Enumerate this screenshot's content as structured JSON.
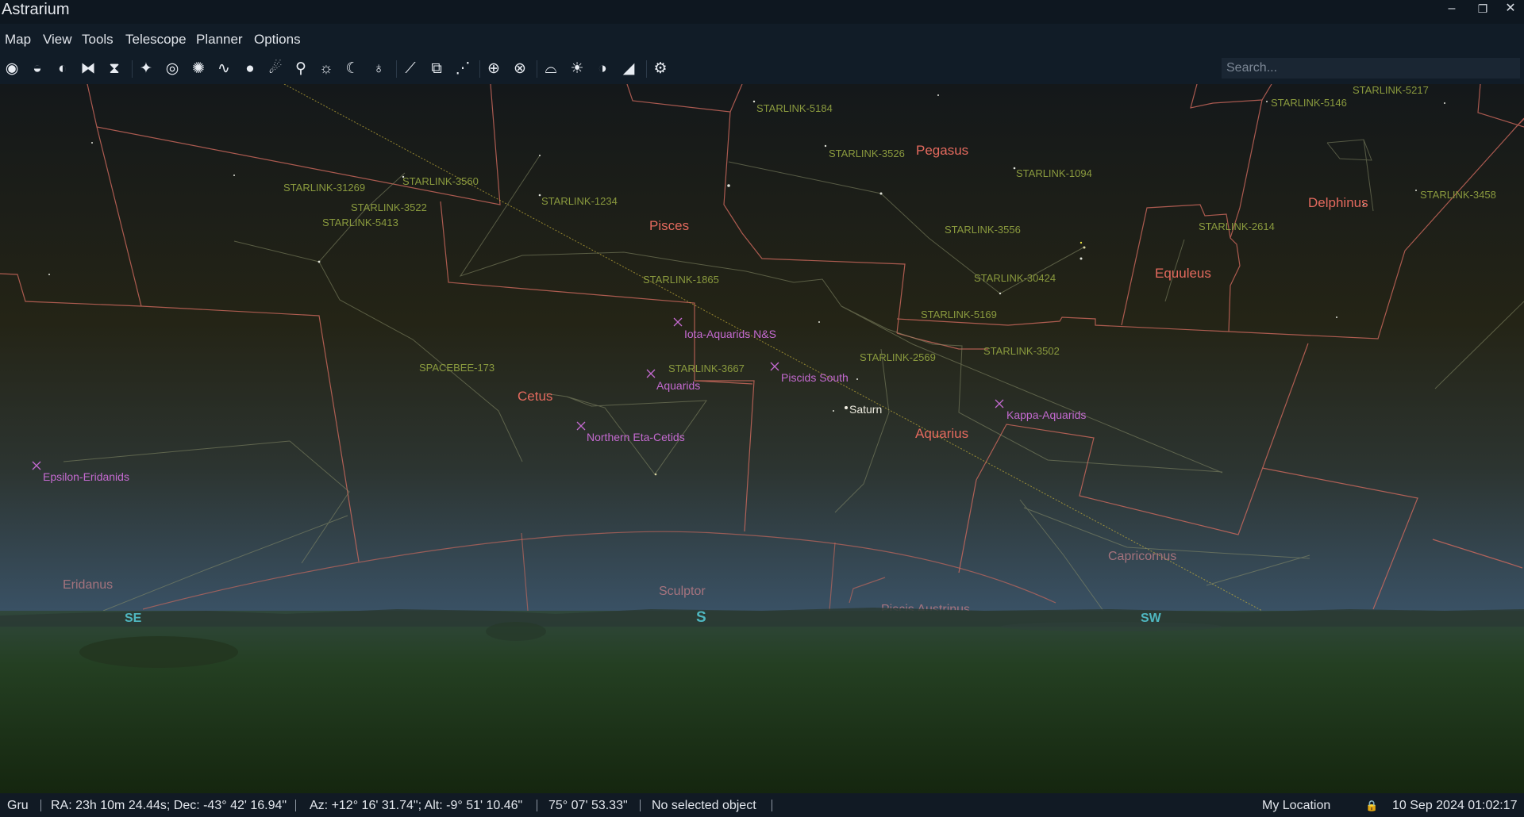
{
  "window": {
    "title": "Astrarium",
    "minimize_glyph": "–",
    "restore_glyph": "❐",
    "close_glyph": "✕"
  },
  "menu": [
    "Map",
    "View",
    "Tools",
    "Telescope",
    "Planner",
    "Options"
  ],
  "toolbar": {
    "buttons": [
      "owl-icon",
      "ground-icon",
      "atmosphere-icon",
      "mirror-flip-icon",
      "invert-icon",
      "stars-icon",
      "galaxy-icon",
      "star-cluster-icon",
      "nebula-icon",
      "comet-icon",
      "asteroid-icon",
      "satellite-icon",
      "sun-icon",
      "moon-icon",
      "planet-icon",
      "constellation-lines-icon",
      "constellation-borders-icon",
      "asterism-icon",
      "equatorial-grid-icon",
      "horizontal-grid-icon",
      "milky-way-icon",
      "daylight-icon",
      "moon-phase-icon",
      "landscape-icon",
      "settings-icon"
    ],
    "search_placeholder": "Search..."
  },
  "sky": {
    "constellations": [
      "Pegasus",
      "Pisces",
      "Delphinus",
      "Equuleus",
      "Cetus",
      "Aquarius",
      "Capricornus",
      "Eridanus",
      "Sculptor",
      "Piscis Austrinus"
    ],
    "satellites": [
      "STARLINK-5184",
      "STARLINK-5146",
      "STARLINK-5217",
      "STARLINK-3526",
      "STARLINK-1094",
      "STARLINK-3458",
      "STARLINK-31269",
      "STARLINK-3560",
      "STARLINK-3522",
      "STARLINK-5413",
      "STARLINK-1234",
      "STARLINK-3556",
      "STARLINK-2614",
      "STARLINK-1865",
      "STARLINK-30424",
      "STARLINK-5169",
      "STARLINK-3502",
      "STARLINK-2569",
      "STARLINK-3667",
      "SPACEBEE-173"
    ],
    "meteor_showers": [
      "Iota-Aquarids N&S",
      "Aquarids",
      "Piscids South",
      "Northern Eta-Cetids",
      "Kappa-Aquarids",
      "Epsilon-Eridanids"
    ],
    "planets": [
      "Saturn"
    ],
    "compass": [
      "SE",
      "S",
      "SW"
    ]
  },
  "status": {
    "location_code": "Gru",
    "ra_dec": "RA: 23h 10m 24.44s; Dec: -43° 42' 16.94\"",
    "az_alt": "Az: +12° 16' 31.74\"; Alt: -9° 51' 10.46\"",
    "fov": "75° 07' 53.33\"",
    "selection": "No selected object",
    "location_name": "My Location",
    "lock_glyph": "🔒",
    "datetime": "10 Sep 2024 01:02:17"
  },
  "colors": {
    "boundary": "#d06a5e",
    "constellation_label": "#e46a5e",
    "satellite_label": "#8a9a3e",
    "meteor_label": "#c46ad0",
    "ecliptic": "#c8b23a"
  }
}
